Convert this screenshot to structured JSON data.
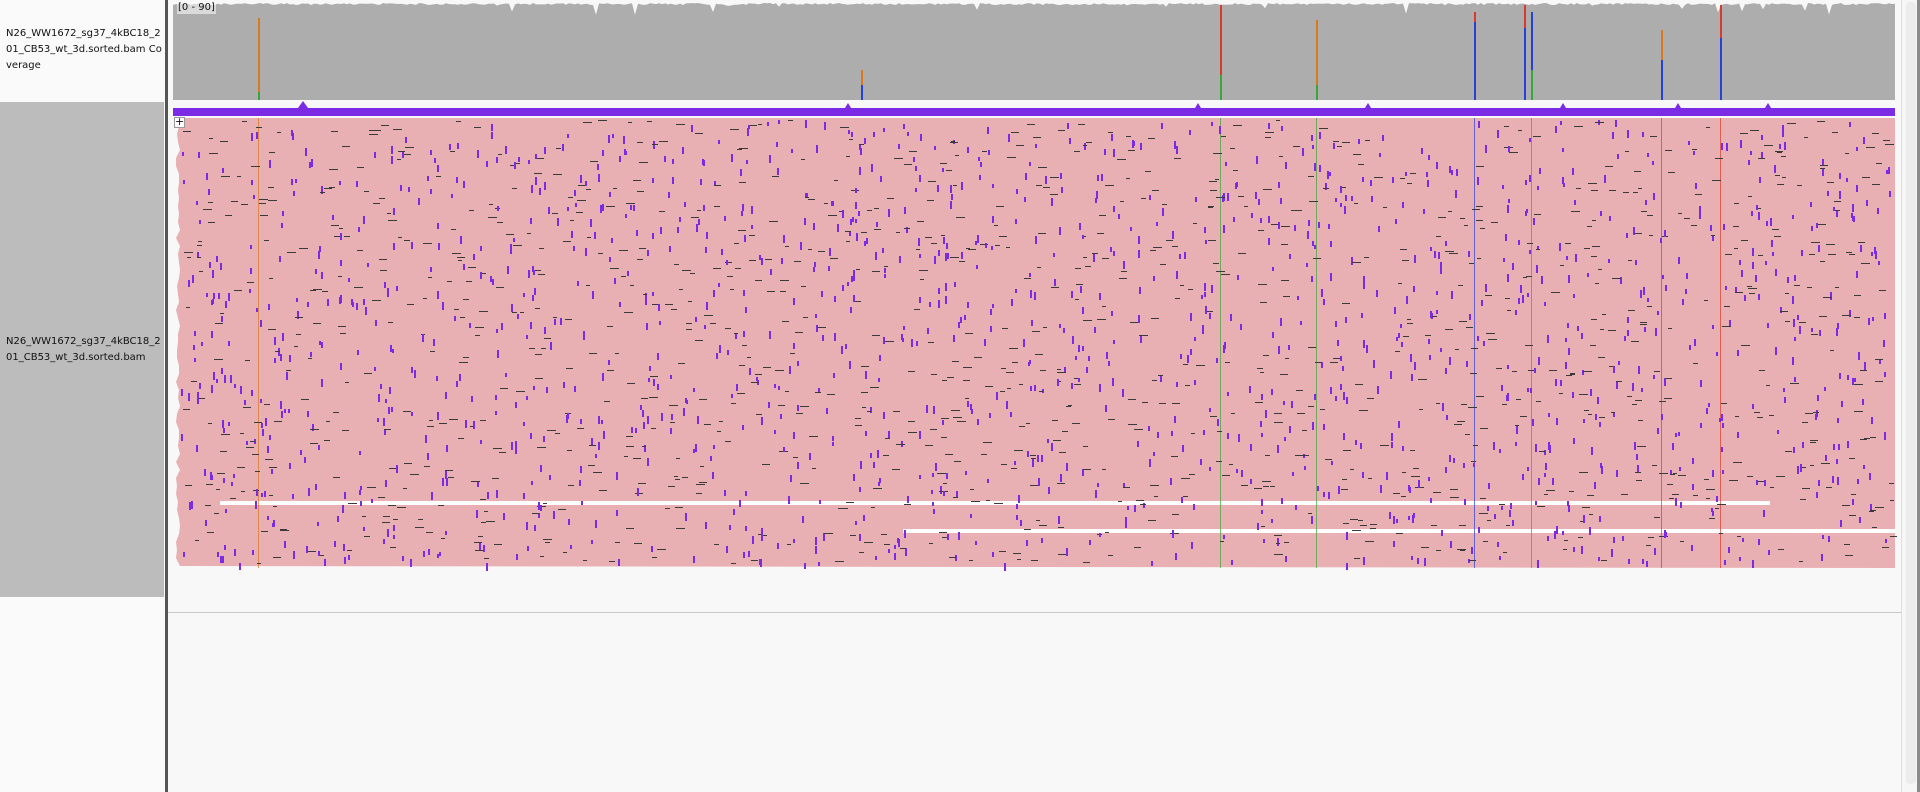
{
  "tracks": {
    "coverage_name": "N26_WW1672_sg37_4kBC18_201_CB53_wt_3d.sorted.bam Coverage",
    "alignment_name": "N26_WW1672_sg37_4kBC18_201_CB53_wt_3d.sorted.bam"
  },
  "coverage": {
    "range_label": "[0 - 90]"
  },
  "alignments": {
    "expand_toggle": "+"
  },
  "colors": {
    "coverage_gray": "#adadad",
    "read_pink": "#e9b0b3",
    "insertion_purple": "#7b2be3",
    "mismatch_red": "#d93a2e",
    "mismatch_green": "#3aa53a",
    "mismatch_blue": "#2740d8",
    "mismatch_orange": "#d6791f"
  }
}
